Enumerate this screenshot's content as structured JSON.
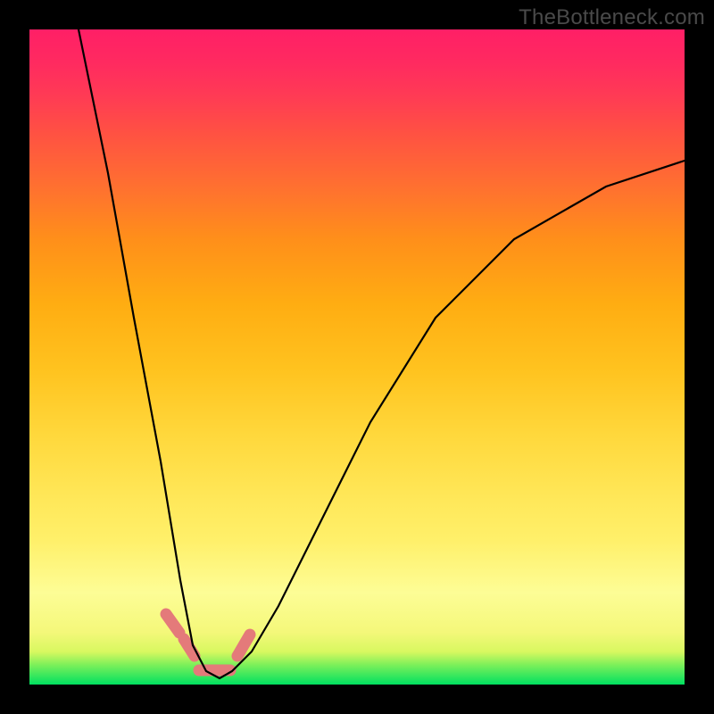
{
  "watermark": "TheBottleneck.com",
  "chart_data": {
    "type": "line",
    "title": "",
    "xlabel": "",
    "ylabel": "",
    "xlim": [
      0,
      100
    ],
    "ylim": [
      0,
      100
    ],
    "grid": false,
    "legend": false,
    "series": [
      {
        "name": "bottleneck-curve",
        "color": "#000000",
        "x": [
          8,
          12,
          16,
          20,
          23,
          25,
          27,
          29,
          31,
          34,
          38,
          44,
          52,
          62,
          74,
          88,
          100
        ],
        "values": [
          100,
          78,
          56,
          34,
          16,
          6,
          2,
          1,
          2,
          5,
          12,
          24,
          40,
          56,
          68,
          76,
          80
        ]
      }
    ],
    "highlight_segments": {
      "color": "#e47a7a",
      "x_ranges": [
        [
          20,
          22
        ],
        [
          22.5,
          24.5
        ],
        [
          25,
          29
        ],
        [
          30,
          32
        ]
      ]
    }
  }
}
